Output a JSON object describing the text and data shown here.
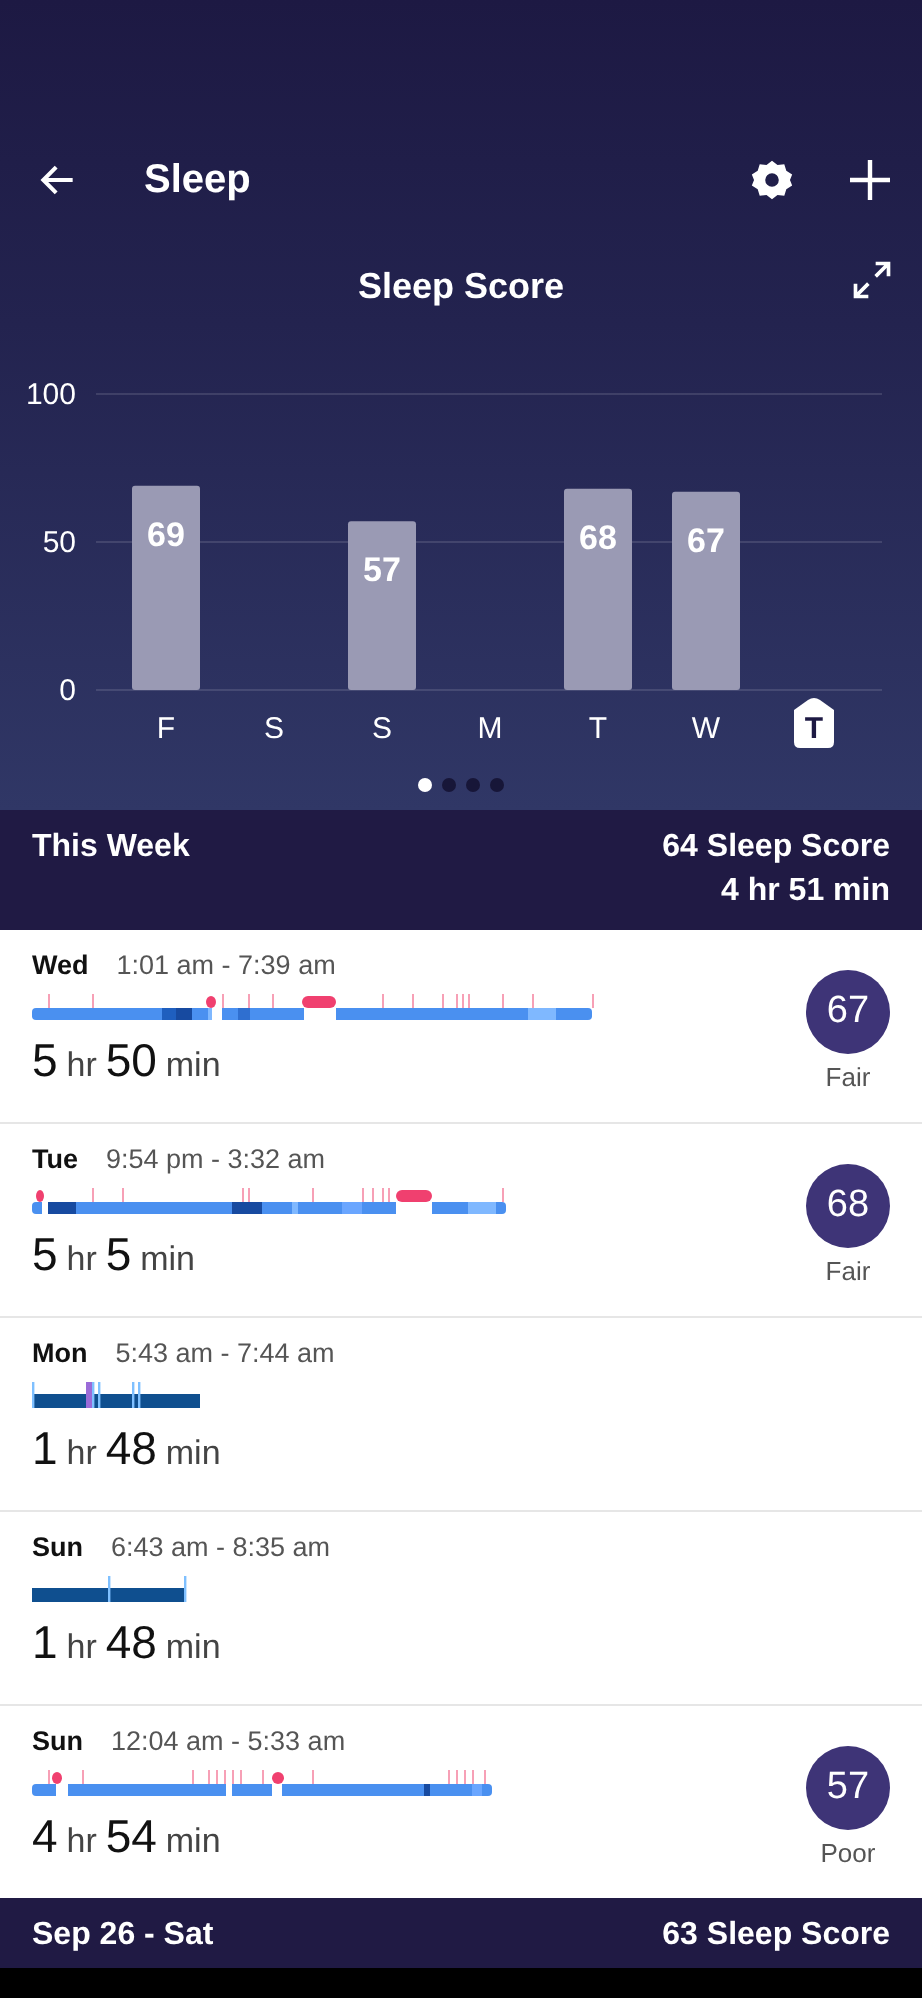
{
  "app_bar": {
    "title": "Sleep"
  },
  "chart": {
    "title": "Sleep Score",
    "chart_data": {
      "type": "bar",
      "categories": [
        "F",
        "S",
        "S",
        "M",
        "T",
        "W",
        "T"
      ],
      "values": [
        69,
        null,
        57,
        null,
        68,
        67,
        null
      ],
      "ylim": [
        0,
        100
      ],
      "yticks": [
        0,
        50,
        100
      ],
      "data_labels": true
    },
    "day_labels": [
      {
        "selected": false
      },
      {
        "selected": false
      },
      {
        "selected": false
      },
      {
        "selected": false
      },
      {
        "selected": false
      },
      {
        "selected": false
      },
      {
        "selected": true
      }
    ]
  },
  "pages": [
    {
      "selected": true
    },
    {
      "selected": false
    },
    {
      "selected": false
    },
    {
      "selected": false
    }
  ],
  "week_summary": {
    "label": "This Week",
    "score": "64 Sleep Score",
    "duration": "4 hr 51 min"
  },
  "entries": [
    {
      "day": "Wed",
      "time": "1:01 am - 7:39 am",
      "kind": "stages",
      "duration": [
        {
          "value": "5",
          "unit": "hr"
        },
        {
          "value": "50",
          "unit": "min"
        }
      ],
      "score": {
        "value": "67",
        "rating": "Fair"
      }
    },
    {
      "day": "Tue",
      "time": "9:54 pm - 3:32 am",
      "kind": "stages",
      "duration": [
        {
          "value": "5",
          "unit": "hr"
        },
        {
          "value": "5",
          "unit": "min"
        }
      ],
      "score": {
        "value": "68",
        "rating": "Fair"
      }
    },
    {
      "day": "Mon",
      "time": "5:43 am - 7:44 am",
      "kind": "classic",
      "duration": [
        {
          "value": "1",
          "unit": "hr"
        },
        {
          "value": "48",
          "unit": "min"
        }
      ]
    },
    {
      "day": "Sun",
      "time": "6:43 am - 8:35 am",
      "kind": "classic",
      "duration": [
        {
          "value": "1",
          "unit": "hr"
        },
        {
          "value": "48",
          "unit": "min"
        }
      ]
    },
    {
      "day": "Sun",
      "time": "12:04 am - 5:33 am",
      "kind": "stages",
      "duration": [
        {
          "value": "4",
          "unit": "hr"
        },
        {
          "value": "54",
          "unit": "min"
        }
      ],
      "score": {
        "value": "57",
        "rating": "Poor"
      }
    }
  ],
  "next_week_summary": {
    "label": "Sep 26 - Sat",
    "score": "63 Sleep Score"
  }
}
